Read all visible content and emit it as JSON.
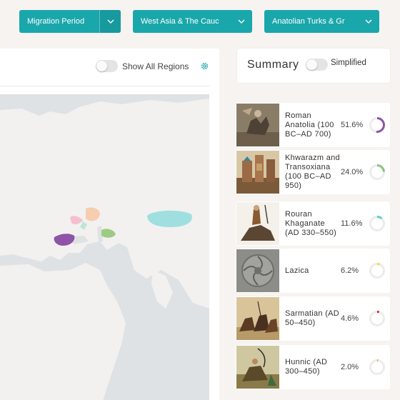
{
  "filters": [
    {
      "label": "Migration Period"
    },
    {
      "label": "West Asia & The Cauc"
    },
    {
      "label": "Anatolian Turks & Gr"
    }
  ],
  "map_panel": {
    "show_all_label": "Show All Regions"
  },
  "summary": {
    "title": "Summary",
    "simplified_label": "Simplified"
  },
  "rows": [
    {
      "name": "Roman Anatolia (100 BC–AD 700)",
      "percent": "51.6%",
      "value": 51.6,
      "color": "#8e54a7"
    },
    {
      "name": "Khwarazm and Transoxiana (100 BC–AD 950)",
      "percent": "24.0%",
      "value": 24.0,
      "color": "#86c47c"
    },
    {
      "name": "Rouran Khaganate (AD 330–550)",
      "percent": "11.6%",
      "value": 11.6,
      "color": "#5ccbd0"
    },
    {
      "name": "Lazica",
      "percent": "6.2%",
      "value": 6.2,
      "color": "#f0e24a"
    },
    {
      "name": "Sarmatian (AD 50–450)",
      "percent": "4.6%",
      "value": 4.6,
      "color": "#e0243f"
    },
    {
      "name": "Hunnic (AD 300–450)",
      "percent": "2.0%",
      "value": 2.0,
      "color": "#f39a3b"
    }
  ],
  "colors": {
    "accent": "#1aa7ab",
    "donut_track": "#ececec"
  },
  "icons": {
    "dropdown": "chevron-down-icon",
    "settings": "gear-icon"
  }
}
